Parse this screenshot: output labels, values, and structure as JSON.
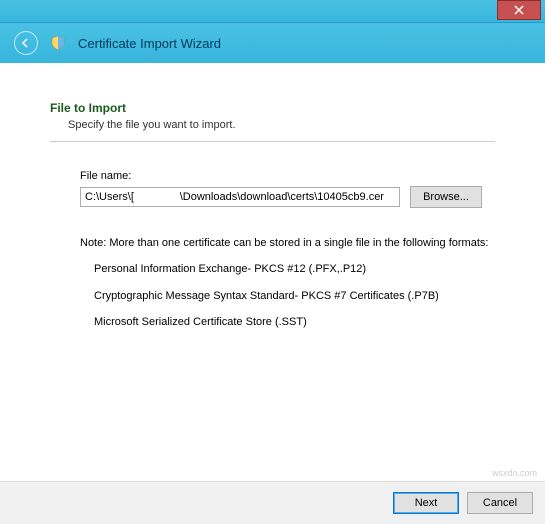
{
  "titlebar": {
    "close_tooltip": "Close"
  },
  "header": {
    "title": "Certificate Import Wizard"
  },
  "main": {
    "section_title": "File to Import",
    "section_subtitle": "Specify the file you want to import.",
    "file_label": "File name:",
    "file_value": "C:\\Users\\[               \\Downloads\\download\\certs\\10405cb9.cer",
    "browse_label": "Browse...",
    "note_text": "Note:  More than one certificate can be stored in a single file in the following formats:",
    "formats": [
      "Personal Information Exchange- PKCS #12 (.PFX,.P12)",
      "Cryptographic Message Syntax Standard- PKCS #7 Certificates (.P7B)",
      "Microsoft Serialized Certificate Store (.SST)"
    ]
  },
  "footer": {
    "next_label": "Next",
    "cancel_label": "Cancel"
  },
  "watermark": "wsxdn.com"
}
